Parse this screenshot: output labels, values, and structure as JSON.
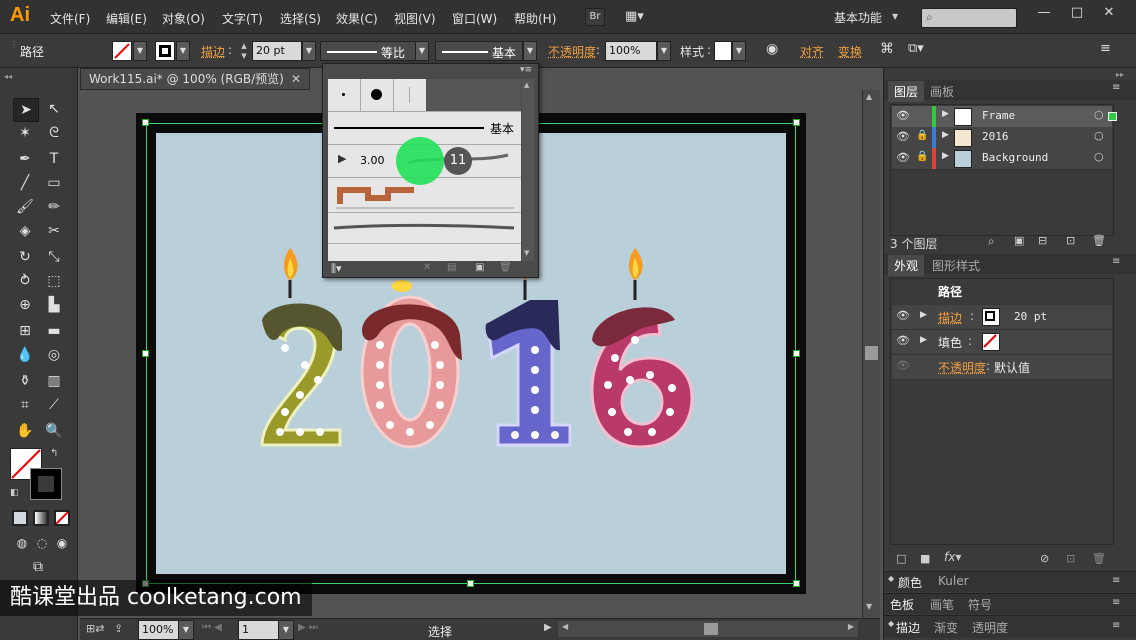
{
  "app": {
    "logo": "Ai",
    "menus": [
      "文件(F)",
      "编辑(E)",
      "对象(O)",
      "文字(T)",
      "选择(S)",
      "效果(C)",
      "视图(V)",
      "窗口(W)",
      "帮助(H)"
    ],
    "bridge_button": "Br",
    "workspace": "基本功能",
    "window_controls": [
      "—",
      "□",
      "✕"
    ]
  },
  "control_bar": {
    "object_type": "路径",
    "stroke_label": "描边",
    "stroke_value": "20 pt",
    "profile_label": "等比",
    "brush_label": "基本",
    "opacity_label": "不透明度",
    "opacity_value": "100%",
    "style_label": "样式",
    "align_label": "对齐",
    "transform_label": "变换"
  },
  "document": {
    "tab_title": "Work115.ai* @ 100% (RGB/预览)",
    "zoom": "100%",
    "page": "1",
    "status_text": "选择",
    "artwork_text": "2016"
  },
  "brush_popup": {
    "basic_label": "基本",
    "size_value": "3.00",
    "click_badge": "11"
  },
  "layers_panel": {
    "tabs": [
      "图层",
      "画板"
    ],
    "layers": [
      {
        "name": "Frame",
        "color": "#2ecc40",
        "selected": true
      },
      {
        "name": "2016",
        "color": "#3a7bd5",
        "selected": false
      },
      {
        "name": "Background",
        "color": "#e04040",
        "selected": false
      }
    ],
    "count_label": "3 个图层"
  },
  "appearance_panel": {
    "tabs": [
      "外观",
      "图形样式"
    ],
    "title": "路径",
    "stroke_label": "描边",
    "stroke_value": "20 pt",
    "fill_label": "填色",
    "opacity_label": "不透明度",
    "opacity_value": "默认值"
  },
  "bottom_panels": {
    "row1_tabs": [
      "颜色",
      "Kuler"
    ],
    "row2_tabs": [
      "色板",
      "画笔",
      "符号"
    ],
    "row3_tabs": [
      "描边",
      "渐变",
      "透明度"
    ]
  },
  "watermark": "酷课堂出品 coolketang.com",
  "colors": {
    "accent_orange": "#ff9a00",
    "click_marker": "#22e05a",
    "artboard_bg": "#b9cfd9"
  }
}
